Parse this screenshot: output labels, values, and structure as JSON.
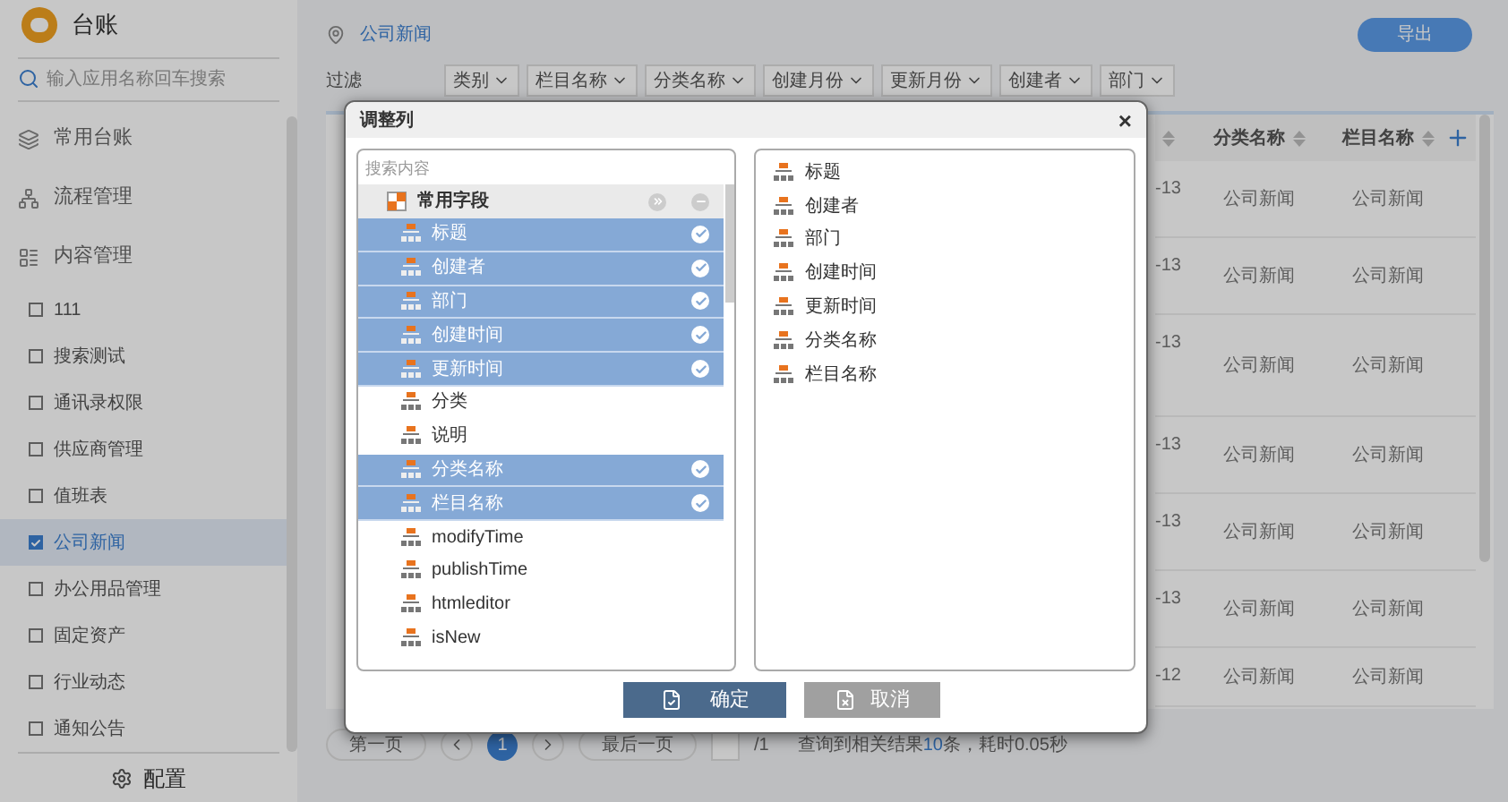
{
  "app": {
    "title": "台账"
  },
  "sidebar": {
    "search": {
      "placeholder": "输入应用名称回车搜索"
    },
    "sections": [
      {
        "label": "常用台账"
      },
      {
        "label": "流程管理"
      },
      {
        "label": "内容管理"
      }
    ],
    "items": [
      {
        "label": "111",
        "selected": false
      },
      {
        "label": "搜索测试",
        "selected": false
      },
      {
        "label": "通讯录权限",
        "selected": false
      },
      {
        "label": "供应商管理",
        "selected": false
      },
      {
        "label": "值班表",
        "selected": false
      },
      {
        "label": "公司新闻",
        "selected": true
      },
      {
        "label": "办公用品管理",
        "selected": false
      },
      {
        "label": "固定资产",
        "selected": false
      },
      {
        "label": "行业动态",
        "selected": false
      },
      {
        "label": "通知公告",
        "selected": false
      }
    ],
    "footer": "配置"
  },
  "breadcrumb": "公司新闻",
  "export_button": "导出",
  "filter": {
    "label": "过滤",
    "chips": [
      "类别",
      "栏目名称",
      "分类名称",
      "创建月份",
      "更新月份",
      "创建者",
      "部门"
    ]
  },
  "table": {
    "columns": [
      "",
      "分类名称",
      "栏目名称"
    ],
    "rows": [
      [
        "-13",
        "公司新闻",
        "公司新闻"
      ],
      [
        "-13",
        "公司新闻",
        "公司新闻"
      ],
      [
        "-13",
        "公司新闻",
        "公司新闻"
      ],
      [
        "-13",
        "公司新闻",
        "公司新闻"
      ],
      [
        "-13",
        "公司新闻",
        "公司新闻"
      ],
      [
        "-13",
        "公司新闻",
        "公司新闻"
      ],
      [
        "-12",
        "公司新闻",
        "公司新闻"
      ]
    ]
  },
  "pagination": {
    "first": "第一页",
    "pages": [
      {
        "label": "1",
        "selected": true
      }
    ],
    "last": "最后一页",
    "total": "/1",
    "result_before": "查询到相关结果",
    "result_count": "10",
    "result_after": "条，耗时0.05秒"
  },
  "dialog": {
    "title": "调整列",
    "close": "×",
    "search": {
      "placeholder": "搜索内容"
    },
    "group": {
      "label": "常用字段",
      "children": [
        {
          "label": "标题",
          "selected": true
        },
        {
          "label": "创建者",
          "selected": true
        },
        {
          "label": "部门",
          "selected": true
        },
        {
          "label": "创建时间",
          "selected": true
        },
        {
          "label": "更新时间",
          "selected": true
        },
        {
          "label": "分类",
          "selected": false
        },
        {
          "label": "说明",
          "selected": false
        },
        {
          "label": "分类名称",
          "selected": true
        },
        {
          "label": "栏目名称",
          "selected": true
        },
        {
          "label": "modifyTime",
          "selected": false
        },
        {
          "label": "publishTime",
          "selected": false
        },
        {
          "label": "htmleditor",
          "selected": false
        },
        {
          "label": "isNew",
          "selected": false
        }
      ]
    },
    "chosen": [
      "标题",
      "创建者",
      "部门",
      "创建时间",
      "更新时间",
      "分类名称",
      "栏目名称"
    ],
    "ok": "确定",
    "cancel": "取消"
  }
}
